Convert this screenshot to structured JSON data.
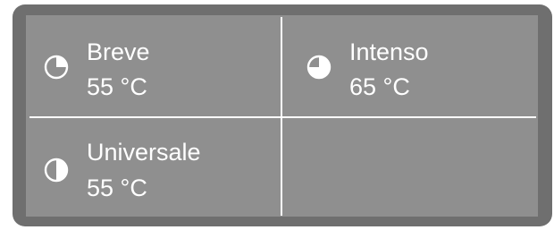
{
  "programs": [
    {
      "name": "Breve",
      "temperature": "55 °C",
      "icon": "pie-quarter-icon",
      "filled_fraction": 0.25
    },
    {
      "name": "Intenso",
      "temperature": "65 °C",
      "icon": "pie-three-quarter-icon",
      "filled_fraction": 0.75
    },
    {
      "name": "Universale",
      "temperature": "55 °C",
      "icon": "pie-half-icon",
      "filled_fraction": 0.5
    }
  ],
  "colors": {
    "bezel": "#6f6f6f",
    "screen": "#8f8f8f",
    "text": "#ffffff",
    "divider": "#ffffff"
  }
}
